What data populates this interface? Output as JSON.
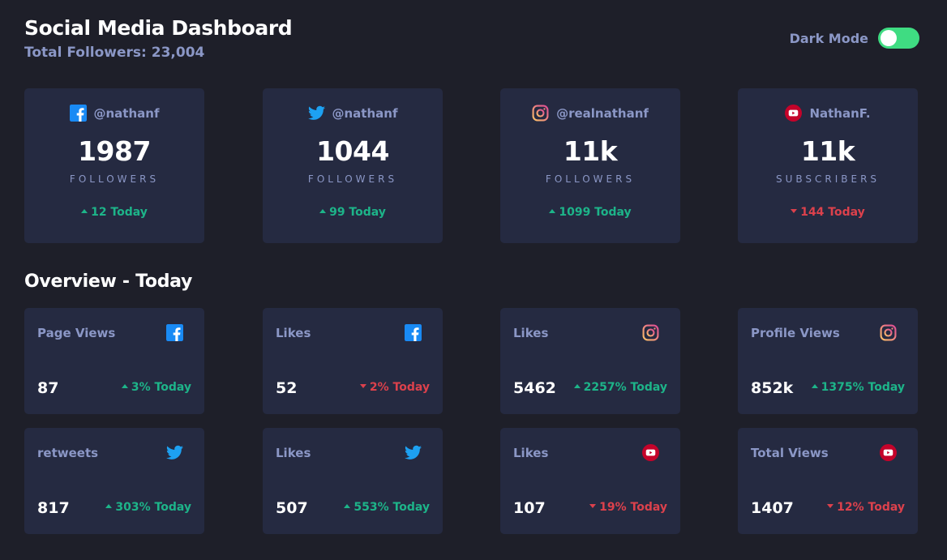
{
  "header": {
    "title": "Social Media Dashboard",
    "subtitle": "Total Followers: 23,004",
    "toggle_label": "Dark Mode",
    "toggle_on": true
  },
  "colors": {
    "background": "#1e1f29",
    "card": "#252a41",
    "text_muted": "#8b97c6",
    "up": "#1db489",
    "down": "#dc414c",
    "toggle_on": "#3fdc82",
    "facebook": "#198af4",
    "twitter": "#1da1f2",
    "instagram": "#f37c69",
    "youtube": "#c4032a"
  },
  "followers": [
    {
      "network": "facebook",
      "icon": "facebook-icon",
      "handle": "@nathanf",
      "count": "1987",
      "metric": "FOLLOWERS",
      "change": "12 Today",
      "trend": "up"
    },
    {
      "network": "twitter",
      "icon": "twitter-icon",
      "handle": "@nathanf",
      "count": "1044",
      "metric": "FOLLOWERS",
      "change": "99 Today",
      "trend": "up"
    },
    {
      "network": "instagram",
      "icon": "instagram-icon",
      "handle": "@realnathanf",
      "count": "11k",
      "metric": "FOLLOWERS",
      "change": "1099 Today",
      "trend": "up"
    },
    {
      "network": "youtube",
      "icon": "youtube-icon",
      "handle": "NathanF.",
      "count": "11k",
      "metric": "SUBSCRIBERS",
      "change": "144 Today",
      "trend": "down"
    }
  ],
  "overview": {
    "title": "Overview - Today",
    "cards": [
      {
        "label": "Page Views",
        "icon": "facebook-icon",
        "value": "87",
        "change": "3% Today",
        "trend": "up"
      },
      {
        "label": "Likes",
        "icon": "facebook-icon",
        "value": "52",
        "change": "2% Today",
        "trend": "down"
      },
      {
        "label": "Likes",
        "icon": "instagram-icon",
        "value": "5462",
        "change": "2257% Today",
        "trend": "up"
      },
      {
        "label": "Profile Views",
        "icon": "instagram-icon",
        "value": "852k",
        "change": "1375% Today",
        "trend": "up"
      },
      {
        "label": "retweets",
        "icon": "twitter-icon",
        "value": "817",
        "change": "303% Today",
        "trend": "up"
      },
      {
        "label": "Likes",
        "icon": "twitter-icon",
        "value": "507",
        "change": "553% Today",
        "trend": "up"
      },
      {
        "label": "Likes",
        "icon": "youtube-icon",
        "value": "107",
        "change": "19% Today",
        "trend": "down"
      },
      {
        "label": "Total Views",
        "icon": "youtube-icon",
        "value": "1407",
        "change": "12% Today",
        "trend": "down"
      }
    ]
  }
}
